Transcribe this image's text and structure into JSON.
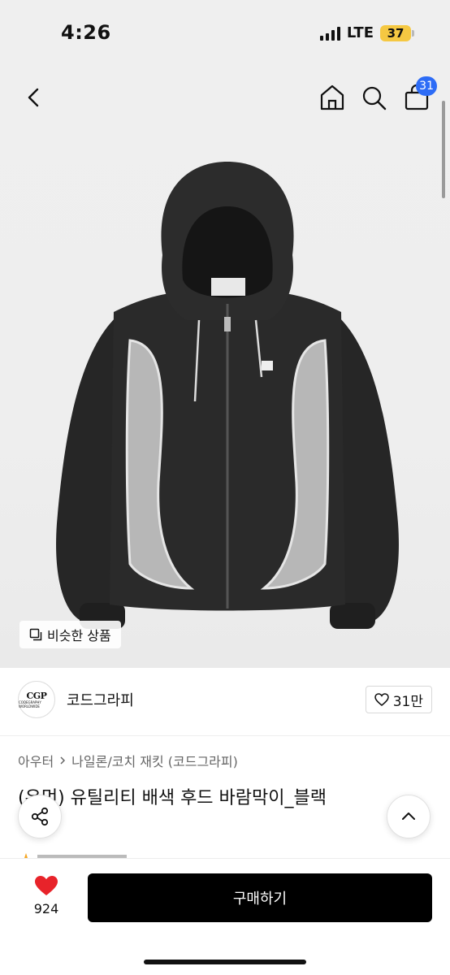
{
  "status_bar": {
    "time": "4:26",
    "network": "LTE",
    "battery": "37"
  },
  "nav": {
    "cart_count": "31"
  },
  "hero": {
    "similar_label": "비슷한 상품"
  },
  "brand": {
    "logo_text": "CGP",
    "logo_subtext": "CODEGRAPHY WORLDWIDE",
    "name": "코드그라피",
    "likes": "31만"
  },
  "product": {
    "breadcrumb": [
      "아우터",
      "나일론/코치 재킷 (코드그라피)"
    ],
    "title": "(우먼) 유틸리티 배색 후드 바람막이_블랙"
  },
  "bottom": {
    "wish_count": "924",
    "buy_label": "구매하기"
  },
  "colors": {
    "badge": "#2d6cf6",
    "heart": "#e8232a",
    "buy_bg": "#000000"
  }
}
